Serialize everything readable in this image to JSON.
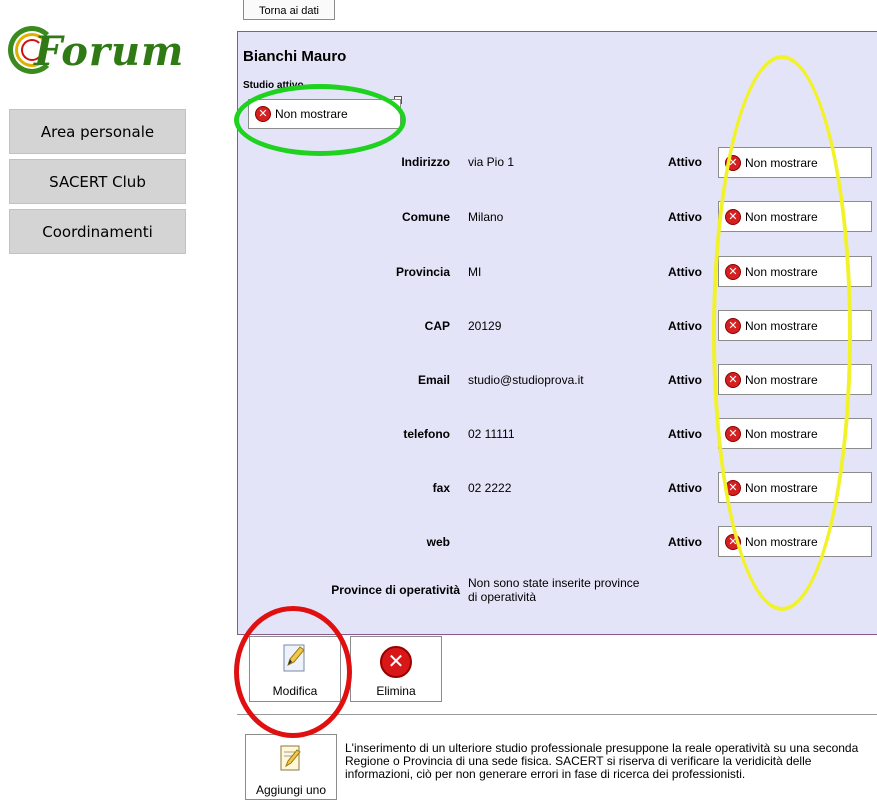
{
  "logo": {
    "text": "Forum"
  },
  "sidebar": {
    "items": [
      {
        "label": "Area personale"
      },
      {
        "label": "SACERT Club"
      },
      {
        "label": "Coordinamenti"
      }
    ]
  },
  "top_button": {
    "label": "Torna ai dati"
  },
  "profile": {
    "name": "Bianchi Mauro",
    "studio_label": "Studio attivo",
    "studio_toggle": "Non mostrare"
  },
  "fields": [
    {
      "label": "Indirizzo",
      "value": "via Pio 1",
      "attivo": "Attivo",
      "toggle": "Non mostrare"
    },
    {
      "label": "Comune",
      "value": "Milano",
      "attivo": "Attivo",
      "toggle": "Non mostrare"
    },
    {
      "label": "Provincia",
      "value": "MI",
      "attivo": "Attivo",
      "toggle": "Non mostrare"
    },
    {
      "label": "CAP",
      "value": "20129",
      "attivo": "Attivo",
      "toggle": "Non mostrare"
    },
    {
      "label": "Email",
      "value": "studio@studioprova.it",
      "attivo": "Attivo",
      "toggle": "Non mostrare"
    },
    {
      "label": "telefono",
      "value": "02 11111",
      "attivo": "Attivo",
      "toggle": "Non mostrare"
    },
    {
      "label": "fax",
      "value": "02 2222",
      "attivo": "Attivo",
      "toggle": "Non mostrare"
    },
    {
      "label": "web",
      "value": "",
      "attivo": "Attivo",
      "toggle": "Non mostrare"
    }
  ],
  "province": {
    "label": "Province di operatività",
    "value_line1": "Non sono state inserite province",
    "value_line2": "di operatività"
  },
  "actions": {
    "modifica": "Modifica",
    "elimina": "Elimina",
    "aggiungi": "Aggiungi uno"
  },
  "note": {
    "line1": "L'inserimento di un ulteriore studio professionale presuppone la reale operatività su una seconda",
    "line2": "Regione o Provincia di una sede fisica. SACERT si riserva di verificare la veridicità delle",
    "line3": "informazioni, ciò per non generare errori in fase di ricerca dei professionisti."
  },
  "colors": {
    "panel_bg": "#e4e4f8",
    "annotation_green": "#1fd21f",
    "annotation_yellow": "#f2f22a",
    "annotation_red": "#e01010"
  }
}
